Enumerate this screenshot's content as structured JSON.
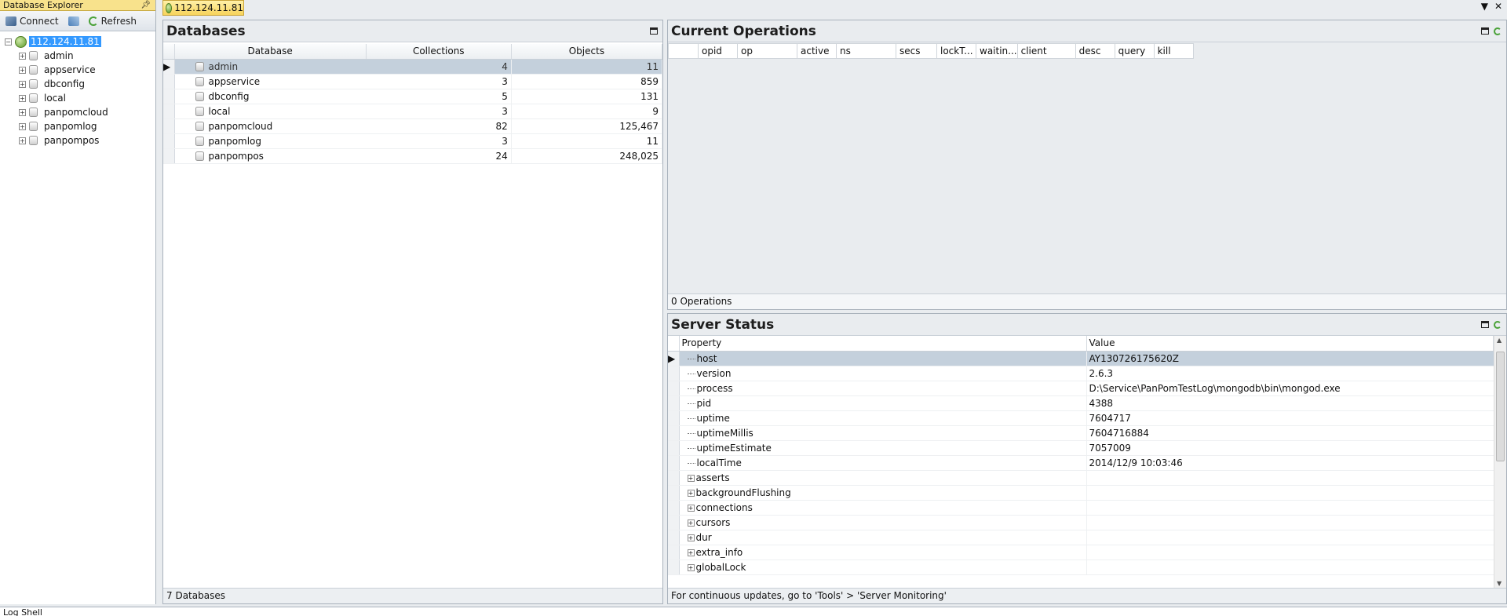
{
  "explorer": {
    "title": "Database Explorer",
    "connect_label": "Connect",
    "refresh_label": "Refresh",
    "host": "112.124.11.81",
    "items": [
      "admin",
      "appservice",
      "dbconfig",
      "local",
      "panpomcloud",
      "panpomlog",
      "panpompos"
    ]
  },
  "tab": {
    "label": "112.124.11.81"
  },
  "databases": {
    "title": "Databases",
    "columns": [
      "Database",
      "Collections",
      "Objects"
    ],
    "rows": [
      {
        "name": "admin",
        "collections": "4",
        "objects": "11"
      },
      {
        "name": "appservice",
        "collections": "3",
        "objects": "859"
      },
      {
        "name": "dbconfig",
        "collections": "5",
        "objects": "131"
      },
      {
        "name": "local",
        "collections": "3",
        "objects": "9"
      },
      {
        "name": "panpomcloud",
        "collections": "82",
        "objects": "125,467"
      },
      {
        "name": "panpomlog",
        "collections": "3",
        "objects": "11"
      },
      {
        "name": "panpompos",
        "collections": "24",
        "objects": "248,025"
      }
    ],
    "status": "7 Databases"
  },
  "operations": {
    "title": "Current Operations",
    "columns": [
      "",
      "opid",
      "op",
      "active",
      "ns",
      "secs",
      "lockT...",
      "waitin...",
      "client",
      "desc",
      "query",
      "kill"
    ],
    "status": "0 Operations"
  },
  "server_status": {
    "title": "Server Status",
    "columns": [
      "Property",
      "Value"
    ],
    "rows": [
      {
        "property": "host",
        "value": "AY130726175620Z",
        "expandable": false
      },
      {
        "property": "version",
        "value": "2.6.3",
        "expandable": false
      },
      {
        "property": "process",
        "value": "D:\\Service\\PanPomTestLog\\mongodb\\bin\\mongod.exe",
        "expandable": false
      },
      {
        "property": "pid",
        "value": "4388",
        "expandable": false
      },
      {
        "property": "uptime",
        "value": "7604717",
        "expandable": false
      },
      {
        "property": "uptimeMillis",
        "value": "7604716884",
        "expandable": false
      },
      {
        "property": "uptimeEstimate",
        "value": "7057009",
        "expandable": false
      },
      {
        "property": "localTime",
        "value": "2014/12/9 10:03:46",
        "expandable": false
      },
      {
        "property": "asserts",
        "value": "",
        "expandable": true
      },
      {
        "property": "backgroundFlushing",
        "value": "",
        "expandable": true
      },
      {
        "property": "connections",
        "value": "",
        "expandable": true
      },
      {
        "property": "cursors",
        "value": "",
        "expandable": true
      },
      {
        "property": "dur",
        "value": "",
        "expandable": true
      },
      {
        "property": "extra_info",
        "value": "",
        "expandable": true
      },
      {
        "property": "globalLock",
        "value": "",
        "expandable": true
      }
    ],
    "status": "For continuous updates, go to 'Tools' > 'Server Monitoring'"
  },
  "bottom": {
    "label": "Log Shell"
  }
}
